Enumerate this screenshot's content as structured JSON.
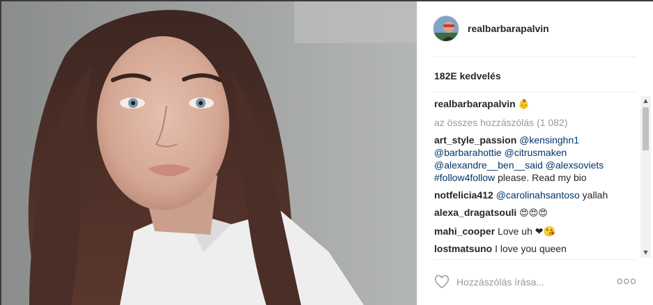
{
  "post": {
    "username": "realbarbarapalvin",
    "likes_label": "182E kedvelés"
  },
  "caption": {
    "username": "realbarbarapalvin",
    "emoji": "👶"
  },
  "view_all_label": "az összes hozzászólás (1 082)",
  "comments": [
    {
      "username": "art_style_passion",
      "mentions": [
        "@kensinghn1",
        "@barbarahottie",
        "@citrusmaken",
        "@alexandre__ben__said",
        "@alexsoviets",
        "#follow4follow"
      ],
      "text": "please. Read my bio"
    },
    {
      "username": "notfelicia412",
      "mentions": [
        "@carolinahsantoso"
      ],
      "text": "yallah"
    },
    {
      "username": "alexa_dragatsouli",
      "text": "😍😍😍"
    },
    {
      "username": "mahi_cooper",
      "text": "Love uh ❤😘"
    },
    {
      "username": "lostmatsuno",
      "text": "I love you queen"
    }
  ],
  "comment_input": {
    "placeholder": "Hozzászólás írása..."
  },
  "more_label": "ooo",
  "icons": {
    "like": "heart-icon",
    "more": "more-options-icon"
  },
  "colors": {
    "link": "#003569",
    "muted": "#999999",
    "text": "#262626"
  }
}
